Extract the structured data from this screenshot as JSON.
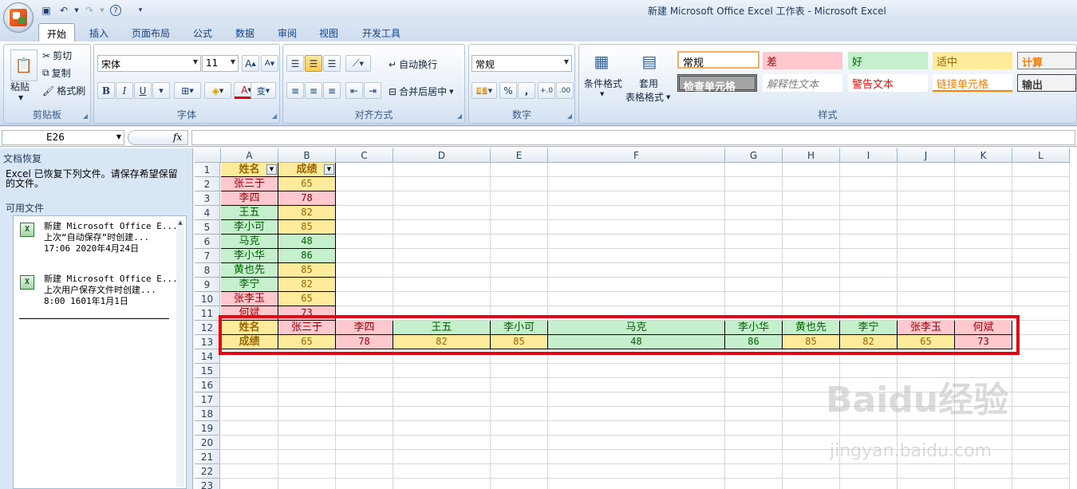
{
  "window": {
    "title": "新建 Microsoft Office Excel 工作表 - Microsoft Excel"
  },
  "tabs": [
    "开始",
    "插入",
    "页面布局",
    "公式",
    "数据",
    "审阅",
    "视图",
    "开发工具"
  ],
  "ribbon": {
    "clipboard": {
      "label": "剪贴板",
      "paste": "粘贴",
      "cut": "剪切",
      "copy": "复制",
      "format_painter": "格式刷"
    },
    "font": {
      "label": "字体",
      "name": "宋体",
      "size": "11",
      "bold": "B",
      "italic": "I",
      "underline": "U",
      "wen": "变"
    },
    "alignment": {
      "label": "对齐方式",
      "wrap": "自动换行",
      "merge": "合并后居中"
    },
    "number": {
      "label": "数字",
      "format": "常规",
      "percent": "%",
      "comma": ","
    },
    "styles": {
      "label": "样式",
      "conditional": "条件格式",
      "table1": "套用",
      "table2": "表格格式",
      "items": [
        "常规",
        "差",
        "好",
        "适中",
        "计算",
        "检查单元格",
        "解释性文本",
        "警告文本",
        "链接单元格",
        "输出"
      ]
    }
  },
  "formula_bar": {
    "name_box": "E26",
    "fx": "fx"
  },
  "task_pane": {
    "title": "文档恢复",
    "message": "Excel 已恢复下列文件。请保存希望保留的文件。",
    "available": "可用文件",
    "files": [
      {
        "icon": "xls-file-icon",
        "name": "新建 Microsoft Office E...",
        "desc": "上次“自动保存”时创建...",
        "time": "17:06 2020年4月24日"
      },
      {
        "icon": "xls-file-icon",
        "name": "新建 Microsoft Office E...",
        "desc": "上次用户保存文件时创建...",
        "time": "8:00 1601年1月1日"
      }
    ]
  },
  "sheet": {
    "columns": [
      "A",
      "B",
      "C",
      "D",
      "E",
      "F",
      "G",
      "H",
      "I",
      "J",
      "K",
      "L"
    ],
    "rows": [
      "1",
      "2",
      "3",
      "4",
      "5",
      "6",
      "7",
      "8",
      "9",
      "10",
      "11",
      "12",
      "13",
      "14",
      "15",
      "16",
      "17",
      "18",
      "19",
      "20",
      "21",
      "22",
      "23"
    ],
    "headers": {
      "name": "姓名",
      "score": "成绩"
    },
    "records": [
      {
        "name": "张三于",
        "score": "65",
        "style": "yel",
        "nstyle": "pink"
      },
      {
        "name": "李四",
        "score": "78",
        "style": "pink",
        "nstyle": "pink"
      },
      {
        "name": "王五",
        "score": "82",
        "style": "yel",
        "nstyle": "grn"
      },
      {
        "name": "李小可",
        "score": "85",
        "style": "yel",
        "nstyle": "grn"
      },
      {
        "name": "马克",
        "score": "48",
        "style": "grn",
        "nstyle": "grn"
      },
      {
        "name": "李小华",
        "score": "86",
        "style": "grn",
        "nstyle": "grn"
      },
      {
        "name": "黄也先",
        "score": "85",
        "style": "yel",
        "nstyle": "grn"
      },
      {
        "name": "李宁",
        "score": "82",
        "style": "yel",
        "nstyle": "grn"
      },
      {
        "name": "张李玉",
        "score": "65",
        "style": "yel",
        "nstyle": "pink"
      },
      {
        "name": "何斌",
        "score": "73",
        "style": "pink",
        "nstyle": "pink"
      }
    ]
  },
  "watermark": {
    "brand": "Baidu经验",
    "url": "jingyan.baidu.com"
  },
  "colors": {
    "highlight": "#e30613",
    "bad_fill": "#ffc7ce",
    "neutral_fill": "#ffeb9c",
    "good_fill": "#c6efce"
  }
}
